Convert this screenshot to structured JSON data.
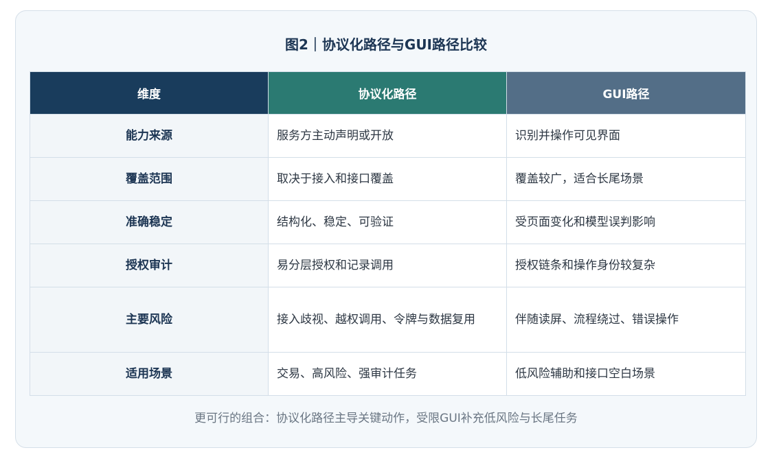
{
  "figure": {
    "title": "图2｜协议化路径与GUI路径比较",
    "note": "更可行的组合：协议化路径主导关键动作，受限GUI补充低风险与长尾任务"
  },
  "table": {
    "headers": [
      "维度",
      "协议化路径",
      "GUI路径"
    ],
    "header_colors": [
      "#193c5c",
      "#2b7a72",
      "#536e87"
    ],
    "rows": [
      [
        "能力来源",
        "服务方主动声明或开放",
        "识别并操作可见界面"
      ],
      [
        "覆盖范围",
        "取决于接入和接口覆盖",
        "覆盖较广，适合长尾场景"
      ],
      [
        "准确稳定",
        "结构化、稳定、可验证",
        "受页面变化和模型误判影响"
      ],
      [
        "授权审计",
        "易分层授权和记录调用",
        "授权链条和操作身份较复杂"
      ],
      [
        "主要风险",
        "接入歧视、越权调用、令牌与数据复用",
        "伴随读屏、流程绕过、错误操作"
      ],
      [
        "适用场景",
        "交易、高风险、强审计任务",
        "低风险辅助和接口空白场景"
      ]
    ]
  }
}
